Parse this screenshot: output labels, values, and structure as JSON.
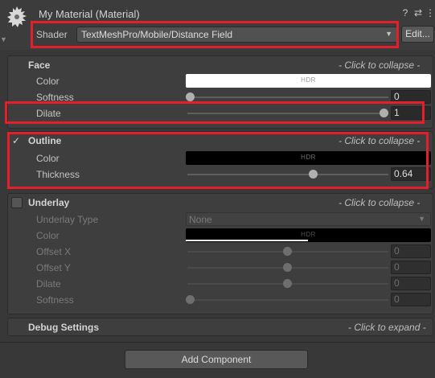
{
  "header": {
    "title": "My Material (Material)",
    "help_icon": "help-icon",
    "settings_icon": "preset-settings-icon",
    "menu_icon": "kebab-menu-icon",
    "help_glyph": "?",
    "settings_glyph": "⇄",
    "menu_glyph": "⋮",
    "shader_label": "Shader",
    "shader_value": "TextMeshPro/Mobile/Distance Field",
    "edit_label": "Edit..."
  },
  "face": {
    "title": "Face",
    "hint": "- Click to collapse -",
    "color_label": "Color",
    "color_hdr": "HDR",
    "color_value": "#ffffff",
    "softness_label": "Softness",
    "softness_value": "0",
    "dilate_label": "Dilate",
    "dilate_value": "1"
  },
  "outline": {
    "check": "✓",
    "checked": true,
    "title": "Outline",
    "hint": "- Click to collapse -",
    "color_label": "Color",
    "color_hdr": "HDR",
    "color_value": "#000000",
    "thickness_label": "Thickness",
    "thickness_value": "0.64"
  },
  "underlay": {
    "checked": false,
    "title": "Underlay",
    "hint": "- Click to collapse -",
    "type_label": "Underlay Type",
    "type_value": "None",
    "color_label": "Color",
    "color_hdr": "HDR",
    "color_value": "#000000",
    "offset_x_label": "Offset X",
    "offset_x_value": "0",
    "offset_y_label": "Offset Y",
    "offset_y_value": "0",
    "dilate_label": "Dilate",
    "dilate_value": "0",
    "softness_label": "Softness",
    "softness_value": "0"
  },
  "debug": {
    "title": "Debug Settings",
    "hint": "- Click to expand -"
  },
  "footer": {
    "add_component_label": "Add Component"
  },
  "colors": {
    "highlight": "#e41e2b",
    "panel_bg": "#383838"
  }
}
